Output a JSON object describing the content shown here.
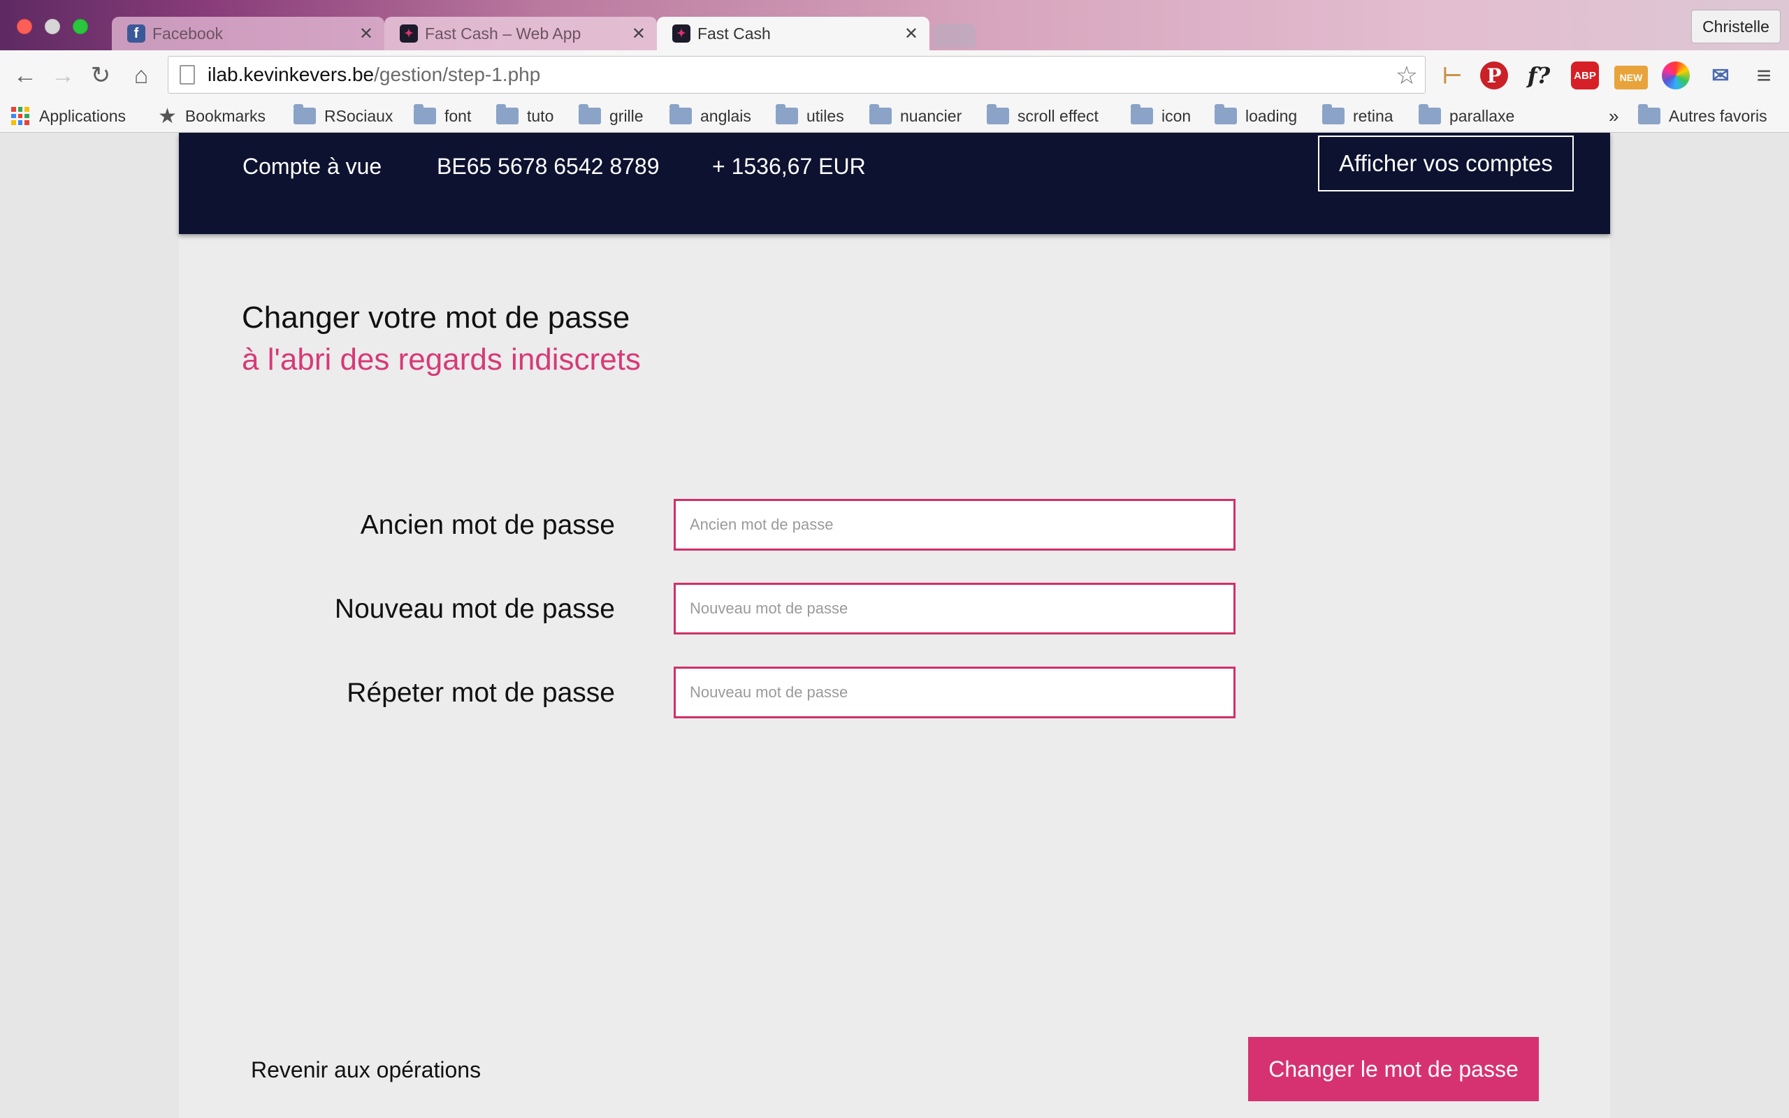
{
  "browser": {
    "tabs": [
      {
        "label": "Facebook",
        "favicon": "facebook-icon"
      },
      {
        "label": "Fast Cash – Web App",
        "favicon": "fastcash-icon"
      },
      {
        "label": "Fast Cash",
        "favicon": "fastcash-icon",
        "active": true
      }
    ],
    "profile_name": "Christelle",
    "url_host": "ilab.kevinkevers.be",
    "url_path": "/gestion/step-1.php",
    "bookmarks": {
      "apps": "Applications",
      "starred": "Bookmarks",
      "folders": [
        "RSociaux",
        "font",
        "tuto",
        "grille",
        "anglais",
        "utiles",
        "nuancier",
        "scroll effect",
        "icon",
        "loading",
        "retina",
        "parallaxe"
      ],
      "overflow": "»",
      "other": "Autres favoris"
    },
    "extensions": {
      "abp": "ABP",
      "new_badge": "NEW",
      "f_label": "f?"
    }
  },
  "account_bar": {
    "type": "Compte à vue",
    "iban": "BE65 5678 6542 8789",
    "balance": "+ 1536,67 EUR",
    "show_accounts_label": "Afficher vos comptes"
  },
  "heading": {
    "title": "Changer votre mot de passe",
    "subtitle": "à l'abri des regards indiscrets"
  },
  "form": {
    "old_password": {
      "label": "Ancien mot de passe",
      "placeholder": "Ancien mot de passe",
      "value": ""
    },
    "new_password": {
      "label": "Nouveau mot de passe",
      "placeholder": "Nouveau mot de passe",
      "value": ""
    },
    "repeat_password": {
      "label": "Répeter mot de passe",
      "placeholder": "Nouveau mot de passe",
      "value": ""
    }
  },
  "actions": {
    "back_label": "Revenir aux opérations",
    "submit_label": "Changer le mot de passe"
  },
  "colors": {
    "accent": "#d63271",
    "header_bg": "#0c1230",
    "page_bg": "#ececec"
  }
}
